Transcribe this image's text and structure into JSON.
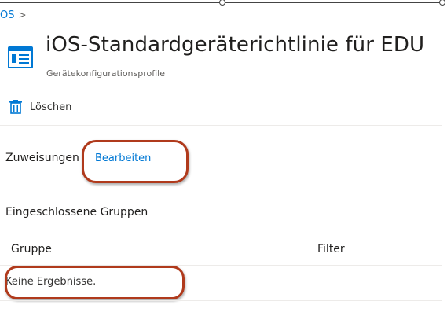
{
  "breadcrumb": {
    "item": "OS",
    "separator": ">"
  },
  "header": {
    "title": "iOS-Standardgeräterichtlinie für EDU",
    "subtitle": "Gerätekonfigurationsprofile",
    "icon": "profile-config-icon"
  },
  "toolbar": {
    "delete_label": "Löschen",
    "delete_icon": "trash-icon"
  },
  "assignments": {
    "label": "Zuweisungen",
    "edit_label": "Bearbeiten"
  },
  "included_groups": {
    "title": "Eingeschlossene Gruppen",
    "columns": [
      "Gruppe",
      "Filter"
    ],
    "empty_text": "Keine Ergebnisse."
  },
  "colors": {
    "accent": "#0078d4",
    "annotation": "#b03a1c",
    "text": "#323130",
    "divider": "#edebe9"
  }
}
